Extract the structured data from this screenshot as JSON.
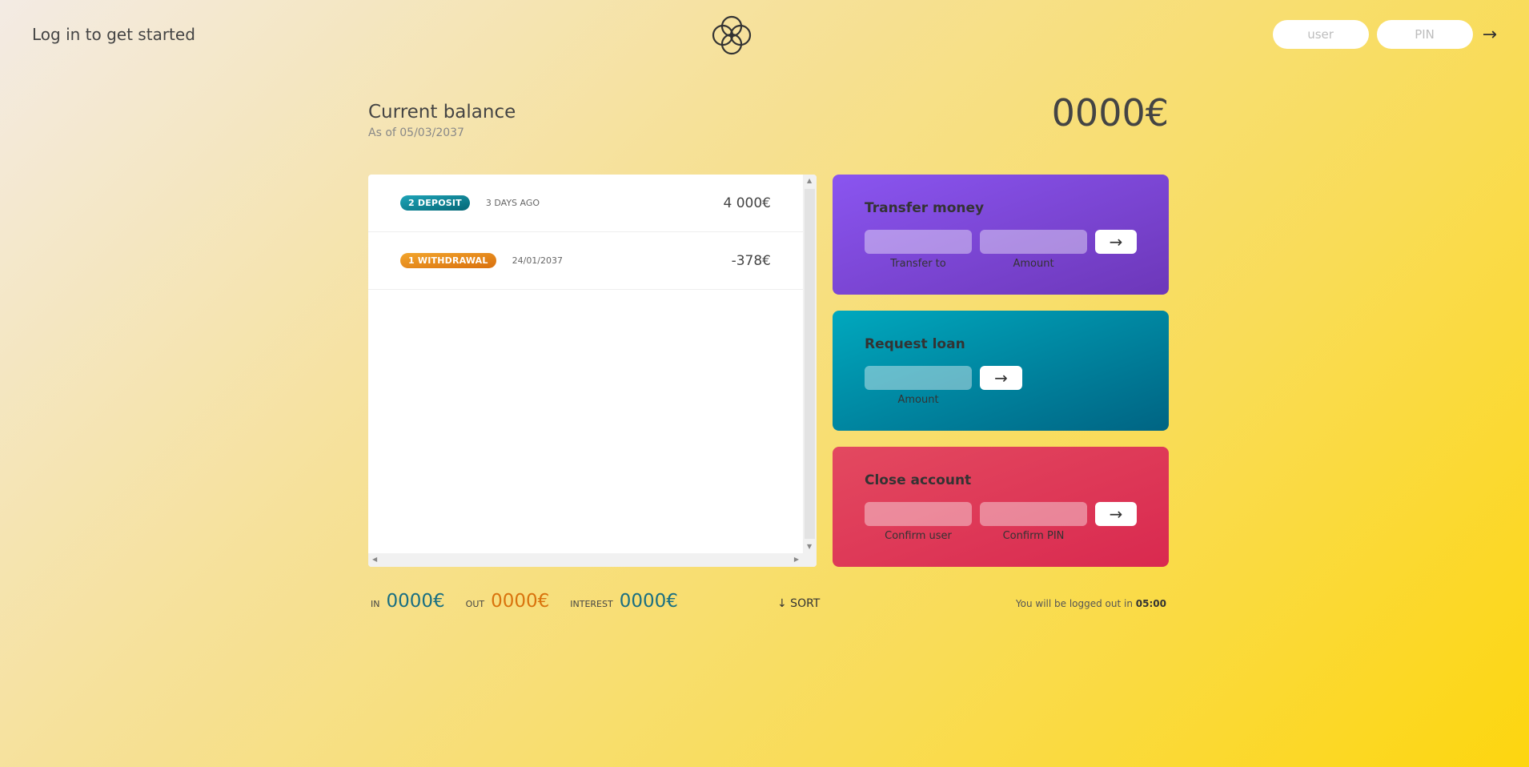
{
  "nav": {
    "welcome": "Log in to get started",
    "user_placeholder": "user",
    "pin_placeholder": "PIN",
    "login_button": "→"
  },
  "balance": {
    "label": "Current balance",
    "date": "As of 05/03/2037",
    "value": "0000€"
  },
  "movements": [
    {
      "type": "2 deposit",
      "kind": "deposit",
      "date": "3 days ago",
      "value": "4 000€"
    },
    {
      "type": "1 withdrawal",
      "kind": "withdrawal",
      "date": "24/01/2037",
      "value": "-378€"
    }
  ],
  "operations": {
    "transfer": {
      "title": "Transfer money",
      "label_to": "Transfer to",
      "label_amount": "Amount",
      "button": "→"
    },
    "loan": {
      "title": "Request loan",
      "label_amount": "Amount",
      "button": "→"
    },
    "close": {
      "title": "Close account",
      "label_user": "Confirm user",
      "label_pin": "Confirm PIN",
      "button": "→"
    }
  },
  "summary": {
    "in_label": "In",
    "in_value": "0000€",
    "out_label": "Out",
    "out_value": "0000€",
    "interest_label": "Interest",
    "interest_value": "0000€",
    "sort_label": "↓ SORT"
  },
  "logout": {
    "text": "You will be logged out in",
    "timer": "05:00"
  },
  "colors": {
    "deposit": "#1ea4b8",
    "withdrawal": "#f2a52c",
    "transfer": "#8a55f0",
    "loan": "#00a8be",
    "close": "#e34960"
  }
}
